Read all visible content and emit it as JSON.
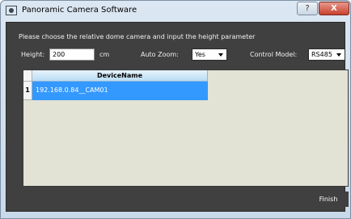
{
  "window": {
    "title": "Panoramic Camera Software",
    "help_label": "?",
    "close_label": "X"
  },
  "form": {
    "instruction": "Please choose the relative dome camera and input the height parameter",
    "height_label": "Height:",
    "height_value": "200",
    "height_unit": "cm",
    "auto_zoom_label": "Auto Zoom:",
    "auto_zoom_value": "Yes",
    "control_model_label": "Control Model:",
    "control_model_value": "RS485"
  },
  "device_table": {
    "columns": [
      "DeviceName"
    ],
    "rows": [
      {
        "index": "1",
        "device_name": "192.168.0.84__CAM01",
        "selected": true
      }
    ]
  },
  "footer": {
    "finish_label": "Finish"
  },
  "colors": {
    "panel_bg": "#404040",
    "list_bg": "#e2e2d5",
    "selection": "#3399ff",
    "header_gradient_top": "#e6f3fc",
    "header_gradient_bottom": "#b9dcf3",
    "close_button": "#c8422e"
  },
  "icons": {
    "app": "camera-app-icon",
    "help": "help-icon",
    "close": "close-icon",
    "dropdown": "chevron-down-icon"
  }
}
